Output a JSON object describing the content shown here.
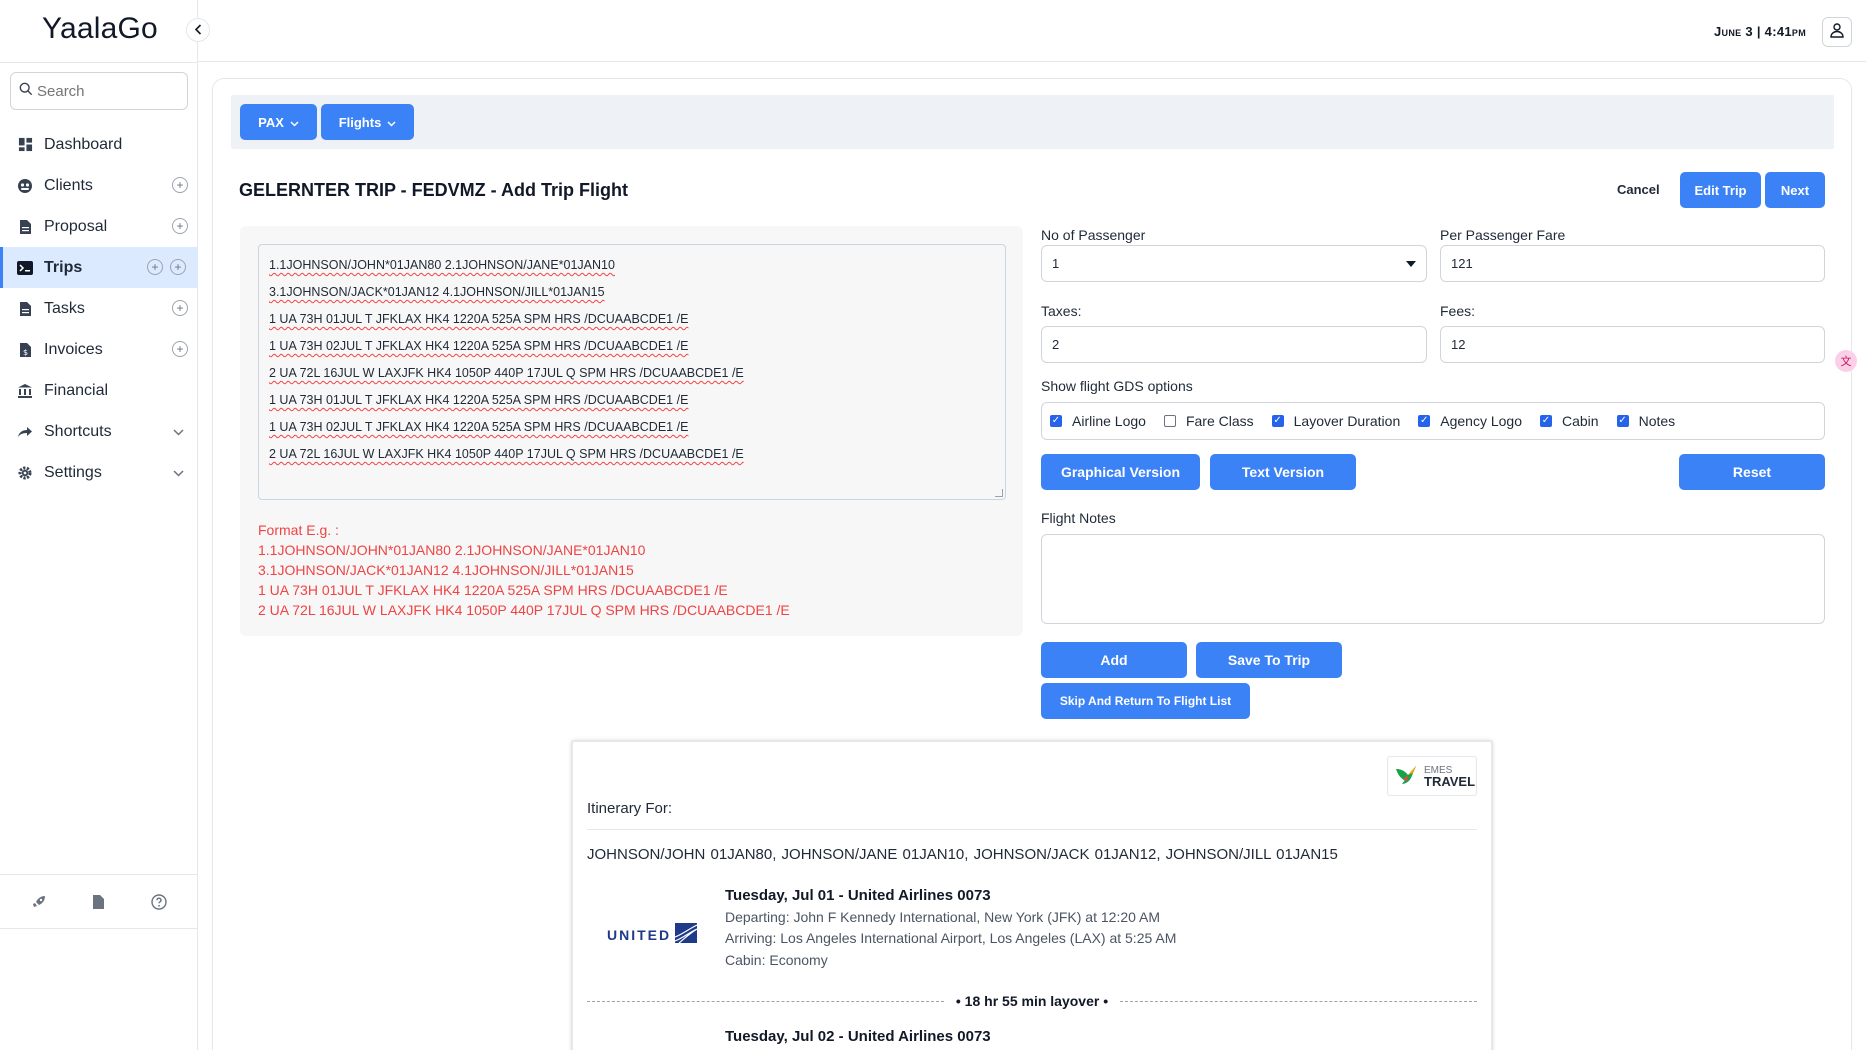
{
  "app": {
    "brand": "YaalaGo",
    "datetime": "June 3 | 4:41pm"
  },
  "sidebar": {
    "search_placeholder": "Search",
    "items": [
      {
        "label": "Dashboard"
      },
      {
        "label": "Clients"
      },
      {
        "label": "Proposal"
      },
      {
        "label": "Trips"
      },
      {
        "label": "Tasks"
      },
      {
        "label": "Invoices"
      },
      {
        "label": "Financial"
      },
      {
        "label": "Shortcuts"
      },
      {
        "label": "Settings"
      }
    ]
  },
  "toolbar": {
    "pax_label": "PAX",
    "flights_label": "Flights"
  },
  "page": {
    "title": "GELERNTER TRIP - FEDVMZ - Add Trip Flight",
    "cancel_label": "Cancel",
    "edit_trip_label": "Edit Trip",
    "next_label": "Next"
  },
  "gds": {
    "lines": [
      "1.1JOHNSON/JOHN*01JAN80 2.1JOHNSON/JANE*01JAN10",
      "3.1JOHNSON/JACK*01JAN12 4.1JOHNSON/JILL*01JAN15",
      "1 UA 73H 01JUL T JFKLAX HK4 1220A 525A SPM HRS /DCUAABCDE1 /E",
      "1 UA 73H 02JUL T JFKLAX HK4 1220A 525A SPM HRS /DCUAABCDE1 /E",
      "2 UA 72L 16JUL W LAXJFK HK4 1050P 440P 17JUL Q SPM HRS /DCUAABCDE1 /E",
      "1 UA 73H 01JUL T JFKLAX HK4 1220A 525A SPM HRS /DCUAABCDE1 /E",
      "1 UA 73H 02JUL T JFKLAX HK4 1220A 525A SPM HRS /DCUAABCDE1 /E",
      "2 UA 72L 16JUL W LAXJFK HK4 1050P 440P 17JUL Q SPM HRS /DCUAABCDE1 /E"
    ],
    "format": {
      "heading": "Format E.g. :",
      "lines": [
        "1.1JOHNSON/JOHN*01JAN80 2.1JOHNSON/JANE*01JAN10",
        "3.1JOHNSON/JACK*01JAN12 4.1JOHNSON/JILL*01JAN15",
        "1 UA 73H 01JUL T JFKLAX HK4 1220A 525A SPM HRS /DCUAABCDE1 /E",
        "2 UA 72L 16JUL W LAXJFK HK4 1050P 440P 17JUL Q SPM HRS /DCUAABCDE1 /E"
      ]
    }
  },
  "form": {
    "passengers_label": "No of Passenger",
    "passengers_value": "1",
    "fare_label": "Per Passenger Fare",
    "fare_value": "121",
    "taxes_label": "Taxes:",
    "taxes_value": "2",
    "fees_label": "Fees:",
    "fees_value": "12",
    "gds_options_label": "Show flight GDS options",
    "options": [
      {
        "label": "Airline Logo",
        "checked": true
      },
      {
        "label": "Fare Class",
        "checked": false
      },
      {
        "label": "Layover Duration",
        "checked": true
      },
      {
        "label": "Agency Logo",
        "checked": true
      },
      {
        "label": "Cabin",
        "checked": true
      },
      {
        "label": "Notes",
        "checked": true
      }
    ],
    "graphical_label": "Graphical Version",
    "text_label": "Text Version",
    "reset_label": "Reset",
    "notes_label": "Flight Notes",
    "add_label": "Add",
    "save_label": "Save To Trip",
    "skip_label": "Skip And Return To Flight List"
  },
  "itinerary": {
    "agency_logo_top": "EMES",
    "agency_logo_bottom": "TRAVEL",
    "heading": "Itinerary For:",
    "passengers": "JOHNSON/JOHN 01JAN80,  JOHNSON/JANE 01JAN10,  JOHNSON/JACK 01JAN12,  JOHNSON/JILL 01JAN15",
    "airline_logo_text": "UNITED",
    "segments": [
      {
        "title": "Tuesday, Jul 01 - United Airlines 0073",
        "departing_label": "Departing:",
        "departing": "John F Kennedy International, New York (JFK) at 12:20 AM",
        "arriving_label": "Arriving:",
        "arriving": "Los Angeles International Airport, Los Angeles (LAX) at 5:25 AM",
        "cabin_label": "Cabin:",
        "cabin": "Economy"
      },
      {
        "title": "Tuesday, Jul 02 - United Airlines 0073"
      }
    ],
    "layover": "• 18 hr 55 min layover •"
  },
  "colors": {
    "accent": "#3b82f6",
    "error": "#ef4444",
    "active_nav_bg": "#dbeafe"
  }
}
